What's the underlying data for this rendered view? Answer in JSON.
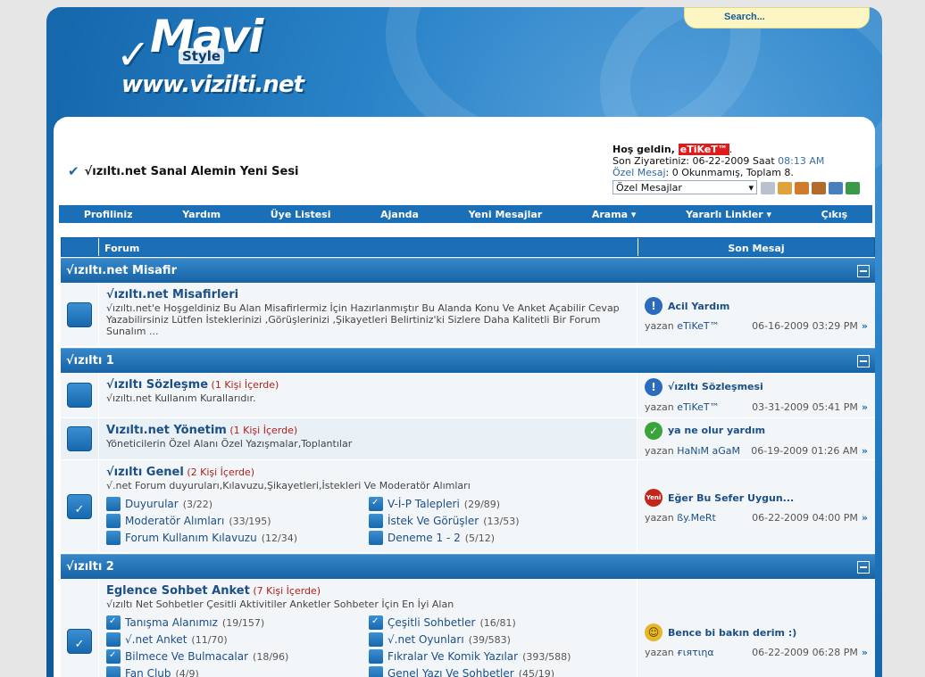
{
  "header": {
    "logo_main": "Mavi",
    "logo_style": "Style",
    "logo_url": "www.vizilti.net",
    "search_label": "Search..."
  },
  "site_title": "√ızıltı.net Sanal Alemin Yeni Sesi",
  "welcome": {
    "greeting": "Hoş geldin, ",
    "username": "eTiKeT™",
    "last_visit_label": "Son Ziyaretiniz: 06-22-2009 Saat ",
    "last_visit_time": "08:13 AM",
    "pm_link": "Özel Mesaj",
    "pm_text": ": 0 Okunmamış, Toplam 8.",
    "pm_select": "Özel Mesajlar"
  },
  "nav": [
    "Profiliniz",
    "Yardım",
    "Üye Listesi",
    "Ajanda",
    "Yeni Mesajlar",
    "Arama ▾",
    "Yararlı Linkler ▾",
    "Çıkış"
  ],
  "table_header": {
    "forum": "Forum",
    "last_post": "Son Mesaj"
  },
  "categories": [
    {
      "title": "√ızıltı.net Misafir"
    },
    {
      "title": "√ızıltı 1"
    },
    {
      "title": "√ızıltı 2"
    }
  ],
  "forums": [
    {
      "title": "√ızıltı.net Misafirleri",
      "viewers": "",
      "desc": "√ızıltı.net'e Hoşgeldiniz Bu Alan Misafirlermiz İçin Hazırlanmıştır Bu Alanda Konu Ve Anket Açabilir Cevap Yazabilirsiniz Lütfen İsteklerinizi ,Görüşlerinizi ,Şikayetleri Belirtiniz'ki Sizlere Daha Kalitetli Bir Forum Sunalım ...",
      "last_title": "Acil Yardım",
      "last_by": "eTiKeT™",
      "last_date": "06-16-2009",
      "last_time": "03:29 PM"
    },
    {
      "title": "√ızıltı Sözleşme",
      "viewers": "(1 Kişi İçerde)",
      "desc": "√ızıltı.net Kullanım Kurallarıdır.",
      "last_title": "√ızıltı Sözleşmesi",
      "last_by": "eTiKeT™",
      "last_date": "03-31-2009",
      "last_time": "05:41 PM"
    },
    {
      "title": "Vızıltı.net Yönetim",
      "viewers": "(1 Kişi İçerde)",
      "desc": "Yöneticilerin Özel Alanı Özel Yazışmalar,Toplantılar",
      "last_title": "ya ne olur yardım",
      "last_by": "HaNıM aGaM",
      "last_date": "06-19-2009",
      "last_time": "01:26 AM"
    },
    {
      "title": "√ızıltı Genel",
      "viewers": "(2 Kişi İçerde)",
      "desc": "√.net Forum duyuruları,Kılavuzu,Şikayetleri,İstekleri Ve Moderatör Alımları",
      "subs": [
        {
          "name": "Duyurular",
          "count": "(3/22)"
        },
        {
          "name": "V-İ-P Talepleri",
          "count": "(29/89)"
        },
        {
          "name": "Moderatör Alımları",
          "count": "(33/195)"
        },
        {
          "name": "İstek Ve Görüşler",
          "count": "(13/53)"
        },
        {
          "name": "Forum Kullanım Kılavuzu",
          "count": "(12/34)"
        },
        {
          "name": "Deneme 1 - 2",
          "count": "(5/12)"
        }
      ],
      "last_title": "Eğer Bu Sefer Uygun...",
      "last_by": "ßy.MeRt",
      "last_date": "06-22-2009",
      "last_time": "04:00 PM"
    },
    {
      "title": "Eglence Sohbet Anket",
      "viewers": "(7 Kişi İçerde)",
      "desc": "√ızıltı Net Sohbetler Çesitli Aktivitiler Anketler Sohbeter İçin En İyi Alan",
      "subs": [
        {
          "name": "Tanışma Alanımız",
          "count": "(19/157)"
        },
        {
          "name": "Çeşitli Sohbetler",
          "count": "(16/81)"
        },
        {
          "name": "√.net Anket",
          "count": "(11/70)"
        },
        {
          "name": "√.net Oyunları",
          "count": "(39/583)"
        },
        {
          "name": "Bilmece Ve Bulmacalar",
          "count": "(18/96)"
        },
        {
          "name": "Fıkralar Ve Komik Yazılar",
          "count": "(393/588)"
        },
        {
          "name": "Fan Club",
          "count": "(4/9)"
        },
        {
          "name": "Genel Yazı Ve Sohbetler",
          "count": "(45/19)"
        }
      ],
      "last_title": "Bence bi bakın derim :)",
      "last_by": "ғιяτιηα",
      "last_date": "06-22-2009",
      "last_time": "06:28 PM"
    }
  ],
  "by_label": "yazan ",
  "colors": {
    "accent": "#1b6fb6",
    "username_bg": "#e01b1b"
  }
}
